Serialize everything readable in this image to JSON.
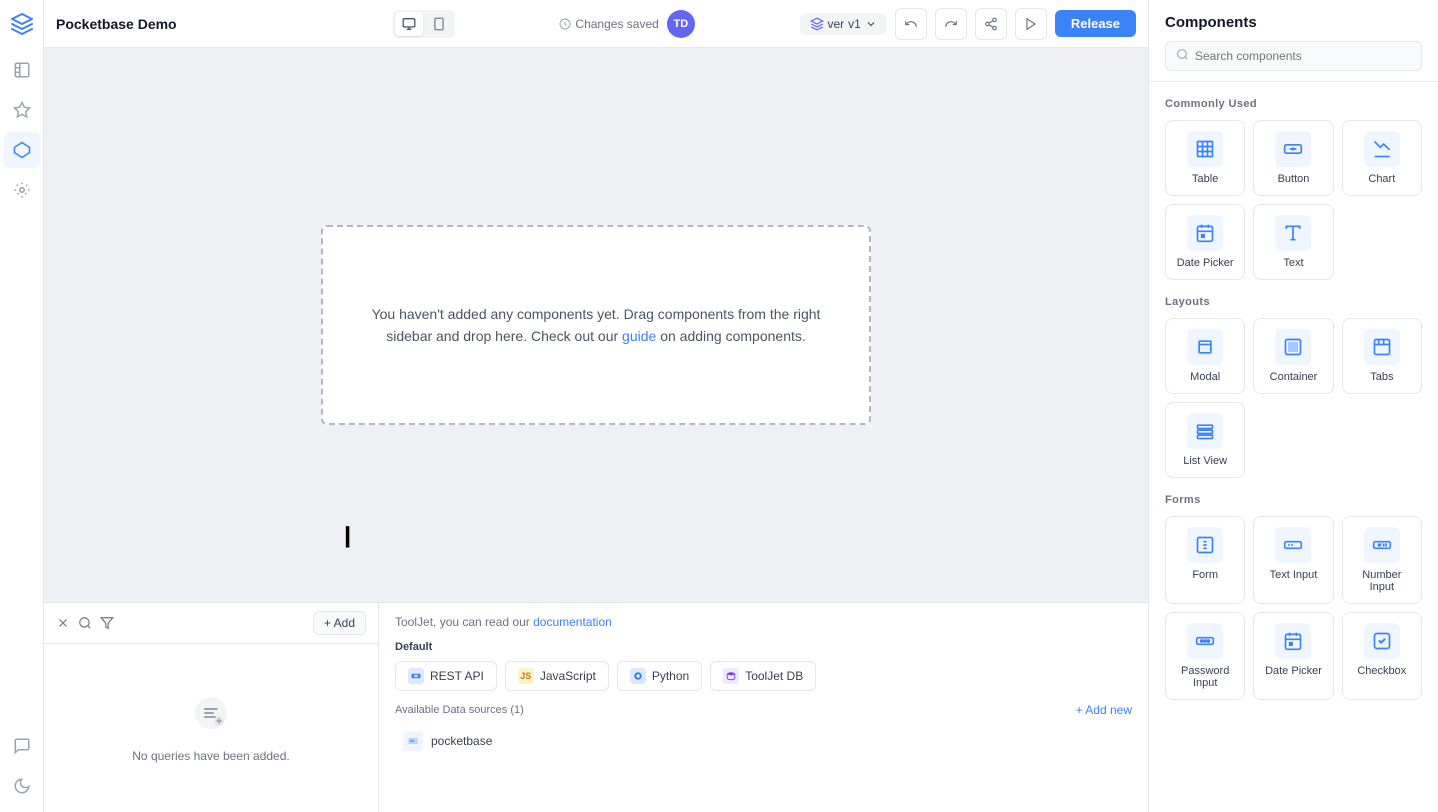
{
  "app": {
    "title": "Pocketbase Demo",
    "changes_saved": "Changes saved",
    "avatar_initials": "TD",
    "version": "ver",
    "version_number": "v1"
  },
  "header": {
    "release_label": "Release",
    "undo_icon": "↩",
    "redo_icon": "↪"
  },
  "canvas": {
    "empty_message": "You haven't added any components yet. Drag components from the right sidebar and drop here. Check out our",
    "guide_link": "guide",
    "empty_message_end": "on adding components."
  },
  "query_panel": {
    "empty_text": "No queries have been added.",
    "add_label": "+ Add"
  },
  "datasource_panel": {
    "intro_text": "ToolJet, you can read our",
    "doc_link": "documentation",
    "default_label": "Default",
    "rest_api_label": "REST API",
    "javascript_label": "JavaScript",
    "python_label": "Python",
    "tooljet_db_label": "ToolJet DB",
    "available_label": "Available Data sources (1)",
    "add_new_label": "+ Add new",
    "pocketbase_label": "pocketbase"
  },
  "right_sidebar": {
    "title": "Components",
    "search_placeholder": "Search components",
    "commonly_used_label": "Commonly Used",
    "layouts_label": "Layouts",
    "forms_label": "Forms",
    "components": {
      "commonly_used": [
        {
          "id": "table",
          "label": "Table",
          "icon": "⊞"
        },
        {
          "id": "button",
          "label": "Button",
          "icon": "···"
        },
        {
          "id": "chart",
          "label": "Chart",
          "icon": "↗"
        },
        {
          "id": "date-picker",
          "label": "Date Picker",
          "icon": "⊞"
        },
        {
          "id": "text",
          "label": "Text",
          "icon": "A"
        }
      ],
      "layouts": [
        {
          "id": "modal",
          "label": "Modal",
          "icon": "▤"
        },
        {
          "id": "container",
          "label": "Container",
          "icon": "⊞"
        },
        {
          "id": "tabs",
          "label": "Tabs",
          "icon": "⊟"
        },
        {
          "id": "list-view",
          "label": "List View",
          "icon": "☰"
        }
      ],
      "forms": [
        {
          "id": "form",
          "label": "Form",
          "icon": "I"
        },
        {
          "id": "text-input",
          "label": "Text Input",
          "icon": "T_"
        },
        {
          "id": "number-input",
          "label": "Number Input",
          "icon": "1_"
        },
        {
          "id": "password-input",
          "label": "Password Input",
          "icon": "···"
        },
        {
          "id": "date-picker-form",
          "label": "Date Picker",
          "icon": "⊞"
        },
        {
          "id": "checkbox",
          "label": "Checkbox",
          "icon": "✓"
        }
      ]
    }
  }
}
